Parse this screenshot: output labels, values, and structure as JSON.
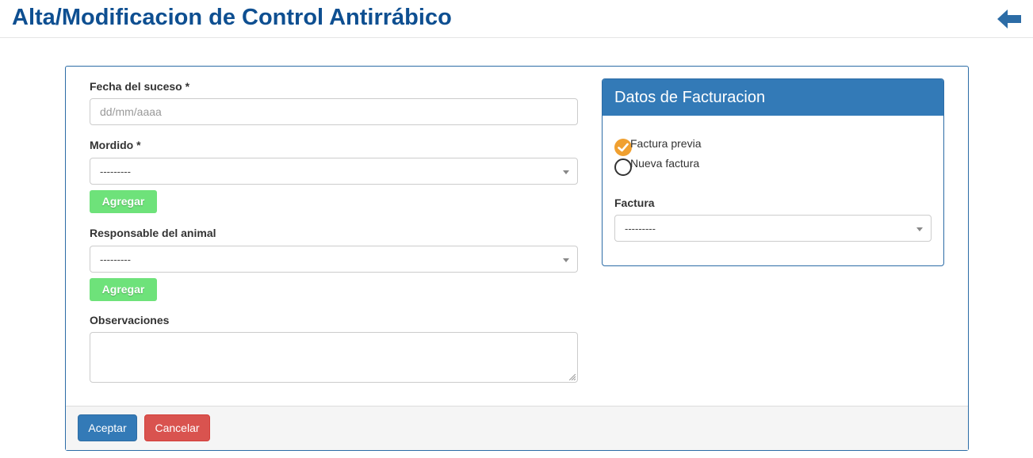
{
  "page": {
    "title": "Alta/Modificacion de Control Antirrábico"
  },
  "form": {
    "fecha_label": "Fecha del suceso *",
    "fecha_placeholder": "dd/mm/aaaa",
    "mordido_label": "Mordido *",
    "mordido_value": "---------",
    "mordido_add": "Agregar",
    "responsable_label": "Responsable del animal",
    "responsable_value": "---------",
    "responsable_add": "Agregar",
    "observaciones_label": "Observaciones",
    "observaciones_value": ""
  },
  "billing": {
    "title": "Datos de Facturacion",
    "options": [
      {
        "label": "Factura previa",
        "checked": true
      },
      {
        "label": "Nueva factura",
        "checked": false
      }
    ],
    "factura_label": "Factura",
    "factura_value": "---------"
  },
  "footer": {
    "accept_label": "Aceptar",
    "cancel_label": "Cancelar"
  },
  "colors": {
    "title": "#0e4f91",
    "primary": "#337ab7",
    "add_button": "#6ee27a",
    "danger": "#d9534f",
    "radio_checked": "#f0a030"
  },
  "icons": {
    "back": "arrow-left-icon",
    "caret": "caret-down-icon",
    "check": "check-icon"
  }
}
